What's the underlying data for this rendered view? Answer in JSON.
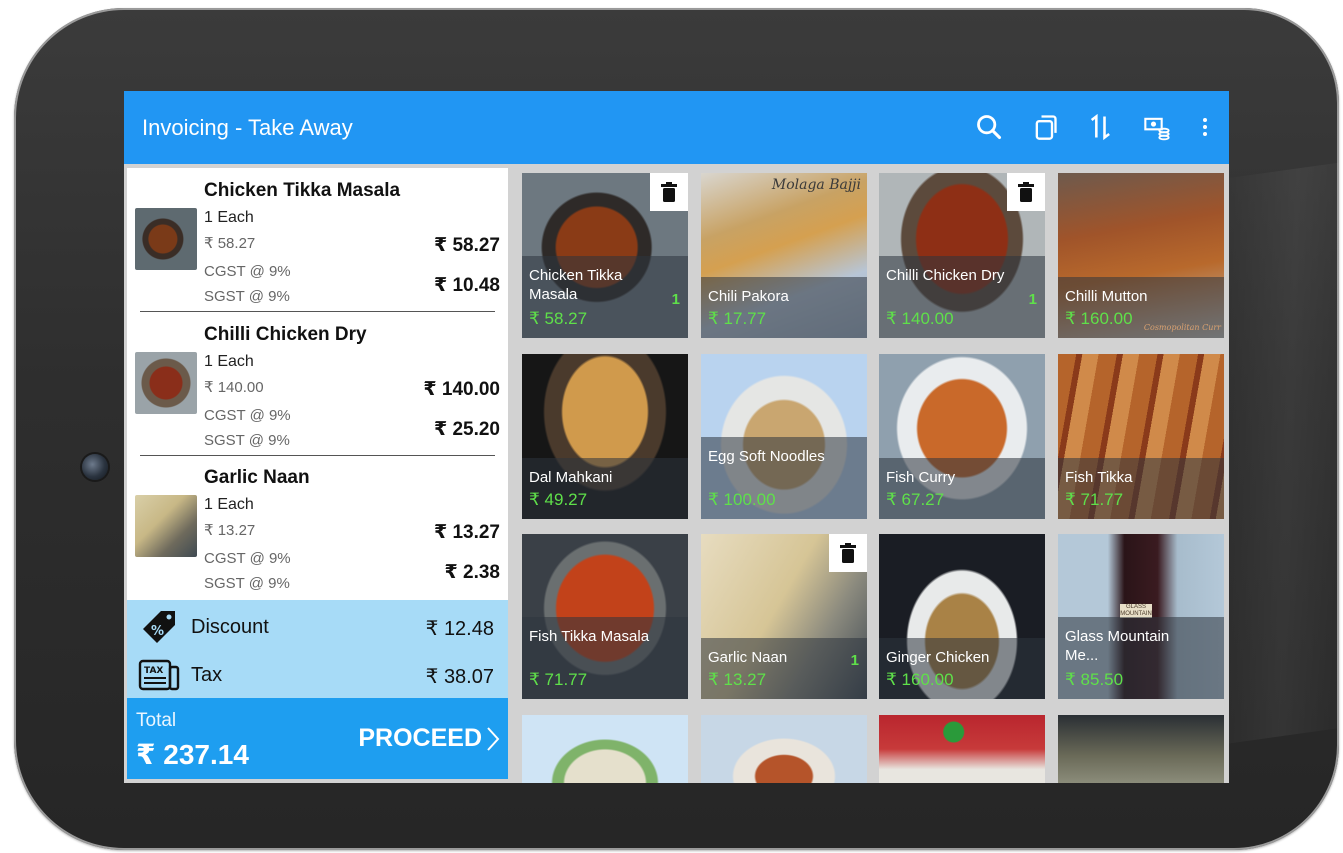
{
  "appbar": {
    "title": "Invoicing - Take Away",
    "icons": [
      "search-icon",
      "copy-icon",
      "sort-icon",
      "cash-icon",
      "more-vert-icon"
    ]
  },
  "cart": {
    "items": [
      {
        "name": "Chicken Tikka Masala",
        "qty": "1 Each",
        "unit_price": "₹ 58.27",
        "amount": "₹ 58.27",
        "cgst_label": "CGST @ 9%",
        "sgst_label": "SGST @ 9%",
        "tax_amount": "₹ 10.48"
      },
      {
        "name": "Chilli Chicken Dry",
        "qty": "1 Each",
        "unit_price": "₹ 140.00",
        "amount": "₹ 140.00",
        "cgst_label": "CGST @ 9%",
        "sgst_label": "SGST @ 9%",
        "tax_amount": "₹ 25.20"
      },
      {
        "name": "Garlic Naan",
        "qty": "1 Each",
        "unit_price": "₹ 13.27",
        "amount": "₹ 13.27",
        "cgst_label": "CGST @ 9%",
        "sgst_label": "SGST @ 9%",
        "tax_amount": "₹ 2.38"
      }
    ],
    "discount": {
      "label": "Discount",
      "value": "₹ 12.48"
    },
    "tax": {
      "label": "Tax",
      "value": "₹ 38.07",
      "icon_text": "TAX"
    },
    "total": {
      "label": "Total",
      "value": "₹ 237.14"
    },
    "proceed_label": "PROCEED"
  },
  "menu": {
    "items": [
      {
        "name": "Chicken Tikka Masala",
        "price": "₹ 58.27",
        "count": "1"
      },
      {
        "name": "Chili Pakora",
        "price": "₹ 17.77",
        "image_text": "Molaga Bajji"
      },
      {
        "name": "Chilli Chicken Dry",
        "price": "₹ 140.00",
        "count": "1"
      },
      {
        "name": "Chilli Mutton",
        "price": "₹ 160.00",
        "image_text": "Cosmopolitan Curr"
      },
      {
        "name": "Dal Mahkani",
        "price": "₹ 49.27"
      },
      {
        "name": "Egg Soft Noodles",
        "price": "₹ 100.00"
      },
      {
        "name": "Fish Curry",
        "price": "₹ 67.27"
      },
      {
        "name": "Fish Tikka",
        "price": "₹ 71.77"
      },
      {
        "name": "Fish Tikka Masala",
        "price": "₹ 71.77"
      },
      {
        "name": "Garlic Naan",
        "price": "₹ 13.27",
        "count": "1"
      },
      {
        "name": "Ginger Chicken",
        "price": "₹ 160.00"
      },
      {
        "name": "Glass Mountain Me...",
        "price": "₹ 85.50",
        "image_text": "GLASS MOUNTAIN"
      }
    ]
  },
  "colors": {
    "primary": "#2196f3",
    "summary_bg": "#a7dbf7",
    "price_green": "#5fe04a"
  }
}
